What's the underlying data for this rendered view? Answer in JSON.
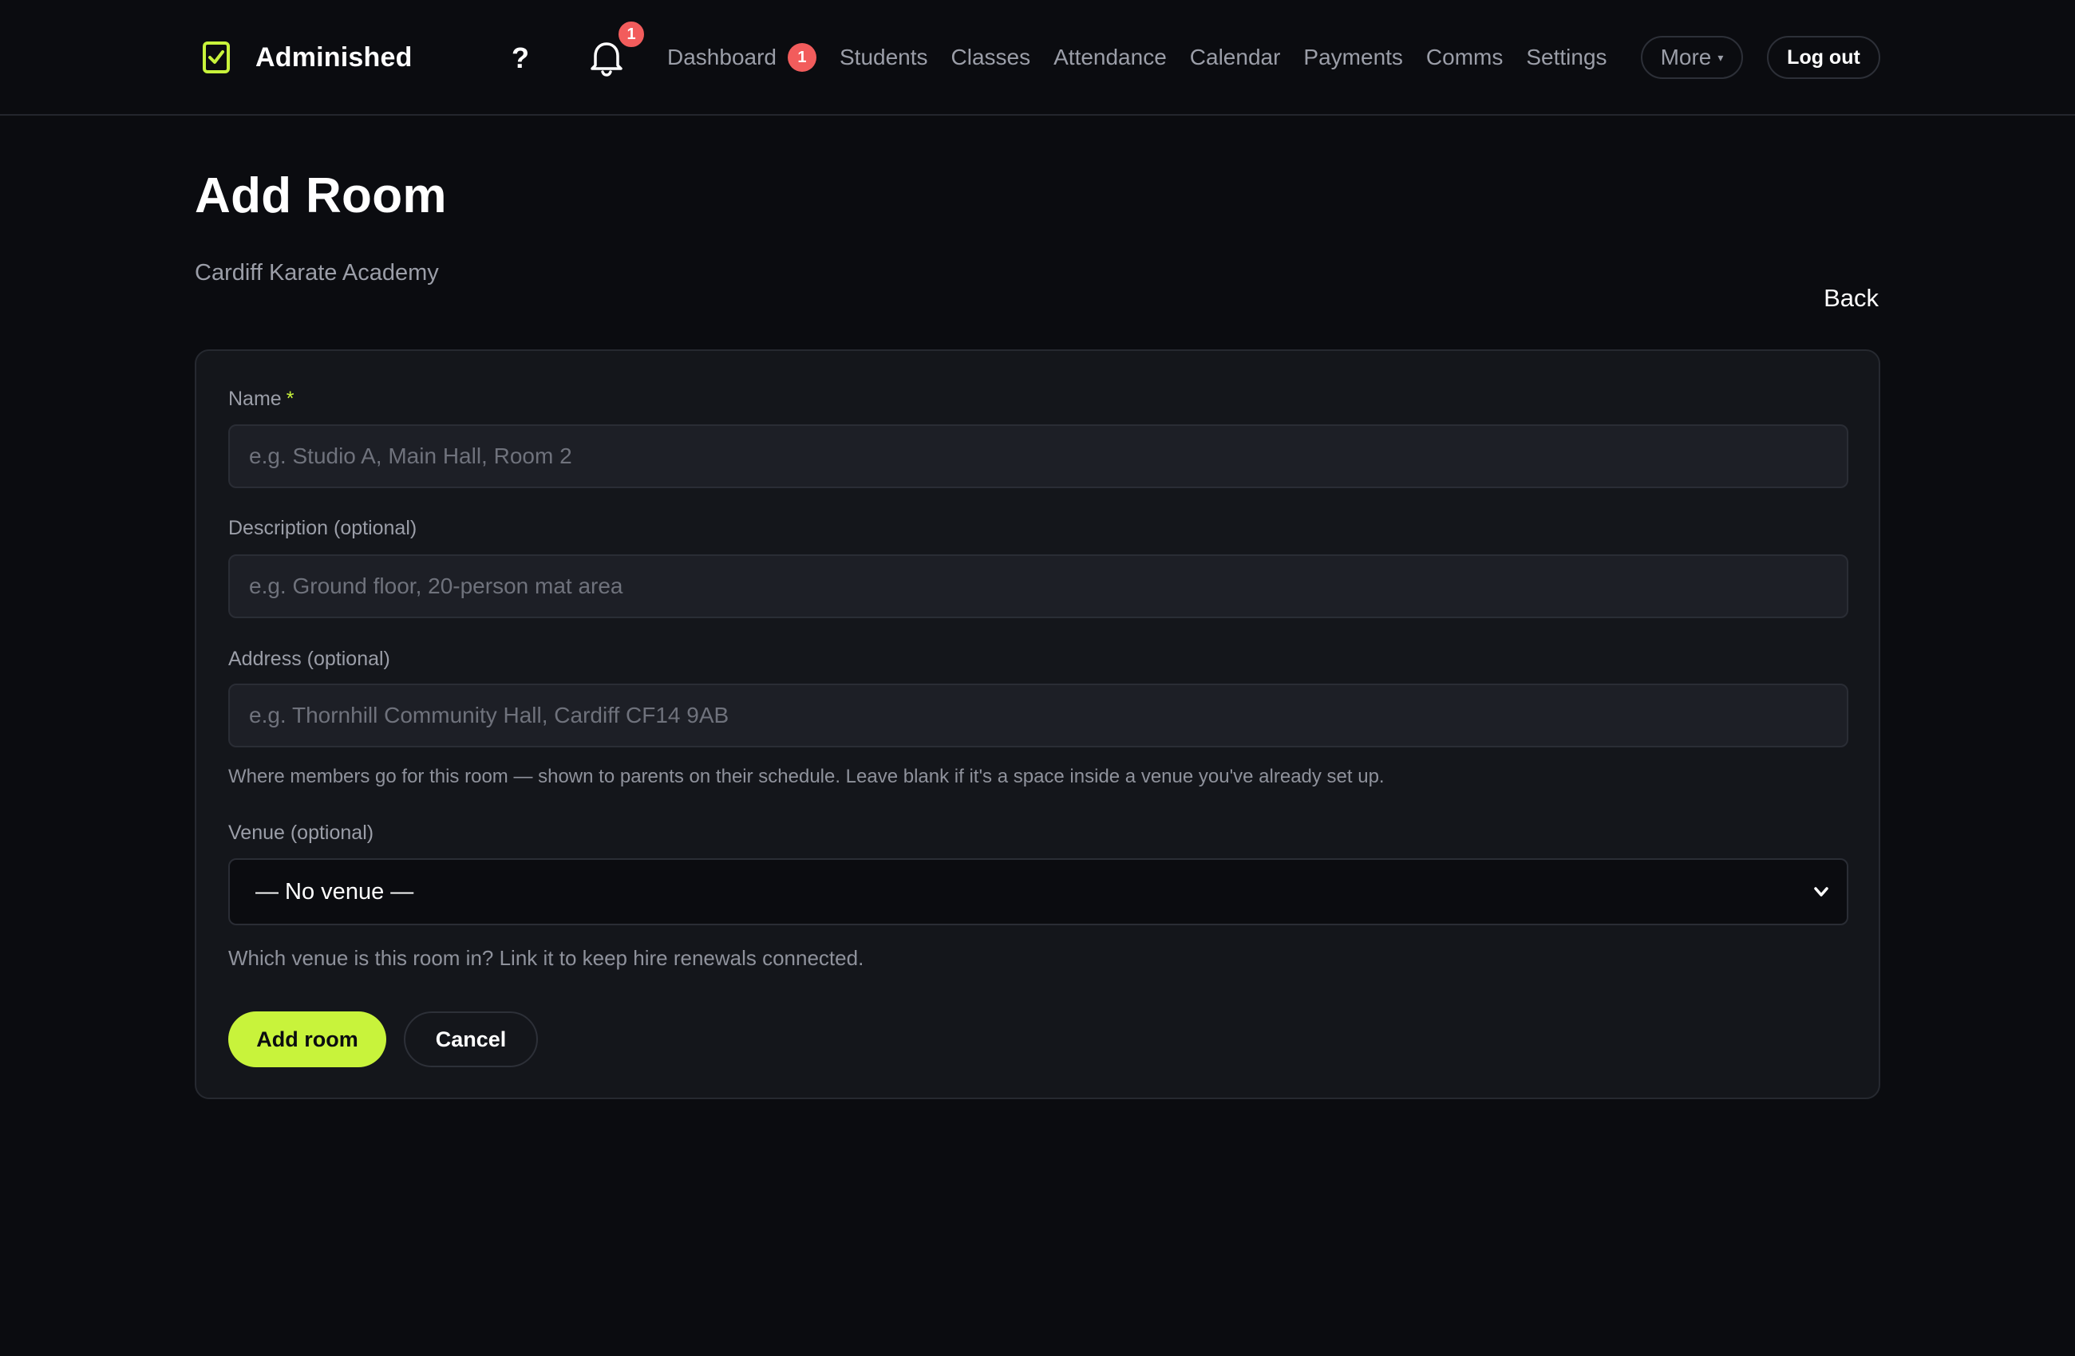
{
  "header": {
    "app_name": "Adminished",
    "help_label": "?",
    "notifications_count": "1",
    "nav": [
      {
        "label": "Dashboard",
        "badge": "1"
      },
      {
        "label": "Students"
      },
      {
        "label": "Classes"
      },
      {
        "label": "Attendance"
      },
      {
        "label": "Calendar"
      },
      {
        "label": "Payments"
      },
      {
        "label": "Comms"
      },
      {
        "label": "Settings"
      }
    ],
    "more_label": "More",
    "more_caret": "▾",
    "logout_label": "Log out"
  },
  "page": {
    "title": "Add Room",
    "subtitle": "Cardiff Karate Academy",
    "back_label": "Back"
  },
  "form": {
    "name": {
      "label": "Name",
      "required_mark": "*",
      "value": "",
      "placeholder": "e.g. Studio A, Main Hall, Room 2"
    },
    "description": {
      "label": "Description (optional)",
      "value": "",
      "placeholder": "e.g. Ground floor, 20-person mat area"
    },
    "address": {
      "label": "Address (optional)",
      "value": "",
      "placeholder": "e.g. Thornhill Community Hall, Cardiff CF14 9AB",
      "hint": "Where members go for this room — shown to parents on their schedule. Leave blank if it's a space inside a venue you've already set up."
    },
    "venue": {
      "label": "Venue (optional)",
      "selected": "— No venue —",
      "hint": "Which venue is this room in? Link it to keep hire renewals connected."
    },
    "submit_label": "Add room",
    "cancel_label": "Cancel"
  },
  "colors": {
    "background": "#0b0c10",
    "card": "#14161b",
    "accent": "#c8f33b",
    "badge": "#f25c5c"
  },
  "icons": {
    "brand": "checkbox-clipboard-icon",
    "help": "question-mark-icon",
    "notifications": "bell-icon",
    "select": "chevron-down-icon"
  }
}
